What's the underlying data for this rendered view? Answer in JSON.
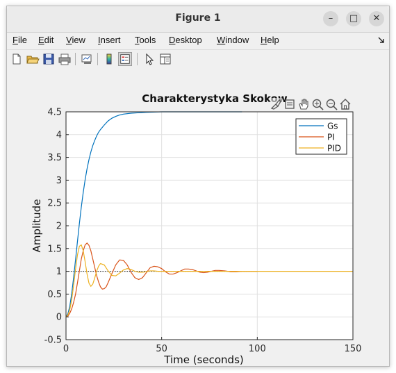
{
  "window": {
    "title": "Figure 1",
    "controls": {
      "minimize": "–",
      "maximize": "□",
      "close": "✕"
    }
  },
  "menubar": {
    "items": [
      {
        "label": "File",
        "key": "F",
        "rest": "ile"
      },
      {
        "label": "Edit",
        "key": "E",
        "rest": "dit"
      },
      {
        "label": "View",
        "key": "V",
        "rest": "iew"
      },
      {
        "label": "Insert",
        "key": "I",
        "rest": "nsert"
      },
      {
        "label": "Tools",
        "key": "T",
        "rest": "ools"
      },
      {
        "label": "Desktop",
        "key": "D",
        "rest": "esktop"
      },
      {
        "label": "Window",
        "key": "W",
        "rest": "indow"
      },
      {
        "label": "Help",
        "key": "H",
        "rest": "elp"
      }
    ],
    "overflow_icon": "arrow-icon"
  },
  "toolbar": {
    "icons": [
      "new-figure-icon",
      "open-file-icon",
      "save-icon",
      "print-icon",
      "link-plot-icon",
      "colorbar-icon",
      "legend-icon",
      "edit-plot-icon",
      "property-inspector-icon"
    ],
    "pressed": "legend-icon"
  },
  "axes_toolbar": {
    "icons": [
      "brush-icon",
      "data-tips-icon",
      "pan-icon",
      "zoom-in-icon",
      "zoom-out-icon",
      "home-icon"
    ]
  },
  "chart_data": {
    "type": "line",
    "title": "Charakterystyka Skokow",
    "xlabel": "Time (seconds)",
    "ylabel": "Amplitude",
    "xlim": [
      0,
      150
    ],
    "ylim": [
      -0.5,
      4.5
    ],
    "xticks": [
      "0",
      "50",
      "100",
      "150"
    ],
    "yticks": [
      "-0.5",
      "0",
      "0.5",
      "1",
      "1.5",
      "2",
      "2.5",
      "3",
      "3.5",
      "4",
      "4.5"
    ],
    "grid": true,
    "legend_position": "top-right",
    "reference_lines": [
      {
        "y": 4.5,
        "x_end": 92,
        "style": "dotted"
      },
      {
        "y": 1.0,
        "x_end": 100,
        "style": "dotted"
      }
    ],
    "series": [
      {
        "name": "Gs",
        "color": "#0072bd",
        "x": [
          0,
          1,
          2,
          3,
          4,
          5,
          6,
          7,
          8,
          9,
          10,
          11,
          12,
          13,
          14,
          15,
          16,
          17,
          18,
          20,
          22,
          24,
          26,
          28,
          30,
          34,
          38,
          42,
          50,
          60,
          70,
          80,
          92
        ],
        "y": [
          0,
          0.07,
          0.24,
          0.52,
          0.87,
          1.26,
          1.66,
          2.05,
          2.41,
          2.73,
          3.01,
          3.25,
          3.45,
          3.62,
          3.76,
          3.87,
          3.97,
          4.05,
          4.11,
          4.21,
          4.3,
          4.36,
          4.4,
          4.43,
          4.45,
          4.47,
          4.48,
          4.49,
          4.5,
          4.5,
          4.5,
          4.5,
          4.5
        ]
      },
      {
        "name": "PI",
        "color": "#d95319",
        "x": [
          0,
          1,
          2,
          3,
          4,
          5,
          6,
          7,
          8,
          9,
          10,
          11,
          12,
          13,
          14,
          15,
          16,
          17,
          18,
          19,
          20,
          21,
          22,
          24,
          26,
          28,
          30,
          32,
          34,
          36,
          38,
          40,
          42,
          44,
          46,
          48,
          50,
          52,
          54,
          56,
          58,
          60,
          62,
          64,
          66,
          68,
          70,
          72,
          74,
          76,
          78,
          80,
          83,
          86,
          89,
          92,
          95,
          100
        ],
        "y": [
          0,
          0.02,
          0.08,
          0.18,
          0.32,
          0.5,
          0.75,
          1.01,
          1.27,
          1.45,
          1.58,
          1.62,
          1.57,
          1.45,
          1.27,
          1.09,
          0.91,
          0.77,
          0.66,
          0.61,
          0.62,
          0.66,
          0.75,
          0.95,
          1.14,
          1.25,
          1.24,
          1.14,
          0.98,
          0.86,
          0.82,
          0.86,
          0.97,
          1.08,
          1.11,
          1.1,
          1.06,
          0.99,
          0.94,
          0.94,
          0.97,
          1.01,
          1.05,
          1.05,
          1.04,
          1.01,
          0.98,
          0.97,
          0.98,
          1.0,
          1.02,
          1.02,
          1.01,
          0.99,
          0.99,
          1.0,
          1.0,
          1.0
        ]
      },
      {
        "name": "PID",
        "color": "#edb120",
        "x": [
          0,
          1,
          2,
          3,
          4,
          5,
          6,
          7,
          8,
          9,
          10,
          11,
          12,
          13,
          14,
          15,
          16,
          17,
          18,
          20,
          22,
          24,
          26,
          28,
          30,
          32,
          34,
          36,
          38,
          40,
          42,
          44,
          46,
          48,
          50,
          55,
          60,
          70,
          80,
          100,
          120,
          150
        ],
        "y": [
          0,
          0.04,
          0.16,
          0.38,
          0.7,
          1.05,
          1.36,
          1.55,
          1.58,
          1.45,
          1.21,
          0.94,
          0.74,
          0.67,
          0.72,
          0.85,
          1.0,
          1.11,
          1.17,
          1.14,
          1.01,
          0.91,
          0.9,
          0.96,
          1.03,
          1.06,
          1.04,
          1.0,
          0.98,
          0.98,
          0.99,
          1.01,
          1.01,
          1.0,
          1.0,
          1.0,
          1.0,
          1.0,
          1.0,
          1.0,
          1.0,
          1.0
        ]
      }
    ]
  }
}
